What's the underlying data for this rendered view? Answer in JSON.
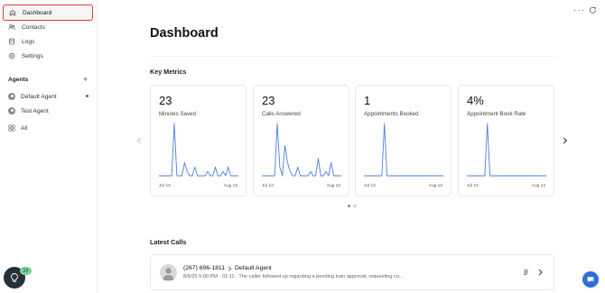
{
  "sidebar": {
    "nav": [
      {
        "label": "Dashboard",
        "icon": "home-icon",
        "active": true
      },
      {
        "label": "Contacts",
        "icon": "contacts-icon"
      },
      {
        "label": "Logs",
        "icon": "database-icon"
      },
      {
        "label": "Settings",
        "icon": "gear-icon"
      }
    ],
    "agents_title": "Agents",
    "agents": [
      {
        "label": "Default Agent",
        "icon": "agent-avatar-icon",
        "status": "active"
      },
      {
        "label": "Test Agent",
        "icon": "agent-avatar-icon"
      }
    ],
    "all_label": "All",
    "badge_count": "22"
  },
  "main": {
    "title": "Dashboard",
    "key_metrics_title": "Key Metrics",
    "metrics": [
      {
        "value": "23",
        "label": "Minutes Saved",
        "start": "Jul 13",
        "end": "Aug 12"
      },
      {
        "value": "23",
        "label": "Calls Answered",
        "start": "Jul 13",
        "end": "Aug 12"
      },
      {
        "value": "1",
        "label": "Appointments Booked",
        "start": "Jul 13",
        "end": "Aug 12"
      },
      {
        "value": "4%",
        "label": "Appointment Book Rate",
        "start": "Jul 13",
        "end": "Aug 12"
      }
    ],
    "latest_calls_title": "Latest Calls",
    "calls": [
      {
        "phone": "(267) 696-1811",
        "agent": "Default Agent",
        "meta": "8/6/25 5:00 PM · 01:11 · The caller followed up regarding a pending loan approval, requesting co..."
      }
    ]
  },
  "colors": {
    "accent": "#3b6de0",
    "highlight": "#e03a3a",
    "chart_line": "#4a7fe0"
  },
  "chart_data": [
    {
      "type": "line",
      "title": "Minutes Saved",
      "x": [
        "Jul 13",
        "Aug 12"
      ],
      "series": [
        {
          "values": [
            0,
            0,
            0,
            0,
            0,
            0,
            12,
            0,
            0,
            0,
            3,
            1,
            0,
            0,
            2,
            0,
            0,
            0,
            0,
            1,
            0,
            0,
            2,
            0,
            0,
            1,
            0,
            2,
            0,
            0,
            0,
            0
          ]
        }
      ]
    },
    {
      "type": "line",
      "title": "Calls Answered",
      "x": [
        "Jul 13",
        "Aug 12"
      ],
      "series": [
        {
          "values": [
            0,
            0,
            0,
            0,
            0,
            0,
            12,
            2,
            0,
            7,
            3,
            1,
            0,
            0,
            2,
            0,
            0,
            0,
            0,
            1,
            0,
            0,
            4,
            0,
            0,
            1,
            0,
            3,
            0,
            0,
            0,
            0
          ]
        }
      ]
    },
    {
      "type": "line",
      "title": "Appointments Booked",
      "x": [
        "Jul 13",
        "Aug 12"
      ],
      "series": [
        {
          "values": [
            0,
            0,
            0,
            0,
            0,
            0,
            0,
            0,
            1,
            0,
            0,
            0,
            0,
            0,
            0,
            0,
            0,
            0,
            0,
            0,
            0,
            0,
            0,
            0,
            0,
            0,
            0,
            0,
            0,
            0,
            0,
            0
          ]
        }
      ]
    },
    {
      "type": "line",
      "title": "Appointment Book Rate",
      "x": [
        "Jul 13",
        "Aug 12"
      ],
      "series": [
        {
          "values": [
            0,
            0,
            0,
            0,
            0,
            0,
            0,
            0,
            1,
            0,
            0,
            0,
            0,
            0,
            0,
            0,
            0,
            0,
            0,
            0,
            0,
            0,
            0,
            0,
            0,
            0,
            0,
            0,
            0,
            0,
            0,
            0
          ]
        }
      ]
    }
  ]
}
